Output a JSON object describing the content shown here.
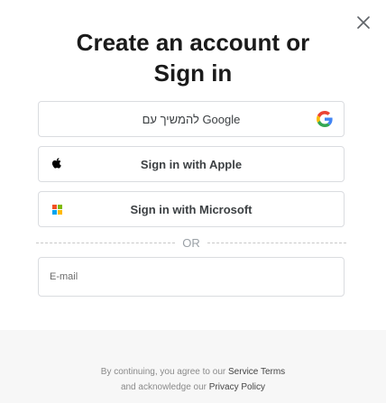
{
  "dialog": {
    "title_line1": "Create an account or",
    "title_line2": "Sign in",
    "close_icon": "close-icon"
  },
  "auth_buttons": {
    "google": {
      "label": "להמשיך עם Google",
      "icon": "google-icon"
    },
    "apple": {
      "label": "Sign in with Apple",
      "icon": "apple-icon"
    },
    "microsoft": {
      "label": "Sign in with Microsoft",
      "icon": "microsoft-icon"
    }
  },
  "divider": {
    "text": "OR"
  },
  "email": {
    "placeholder": "E-mail",
    "value": ""
  },
  "legal": {
    "line1_prefix": "By continuing, you agree to our",
    "terms_link": "Service Terms",
    "line2_prefix": "and acknowledge our",
    "privacy_link": "Privacy Policy"
  },
  "colors": {
    "google_blue": "#4285F4",
    "google_red": "#EA4335",
    "google_yellow": "#FBBC05",
    "google_green": "#34A853",
    "ms_red": "#F25022",
    "ms_green": "#7FBA00",
    "ms_blue": "#00A4EF",
    "ms_yellow": "#FFB900"
  }
}
